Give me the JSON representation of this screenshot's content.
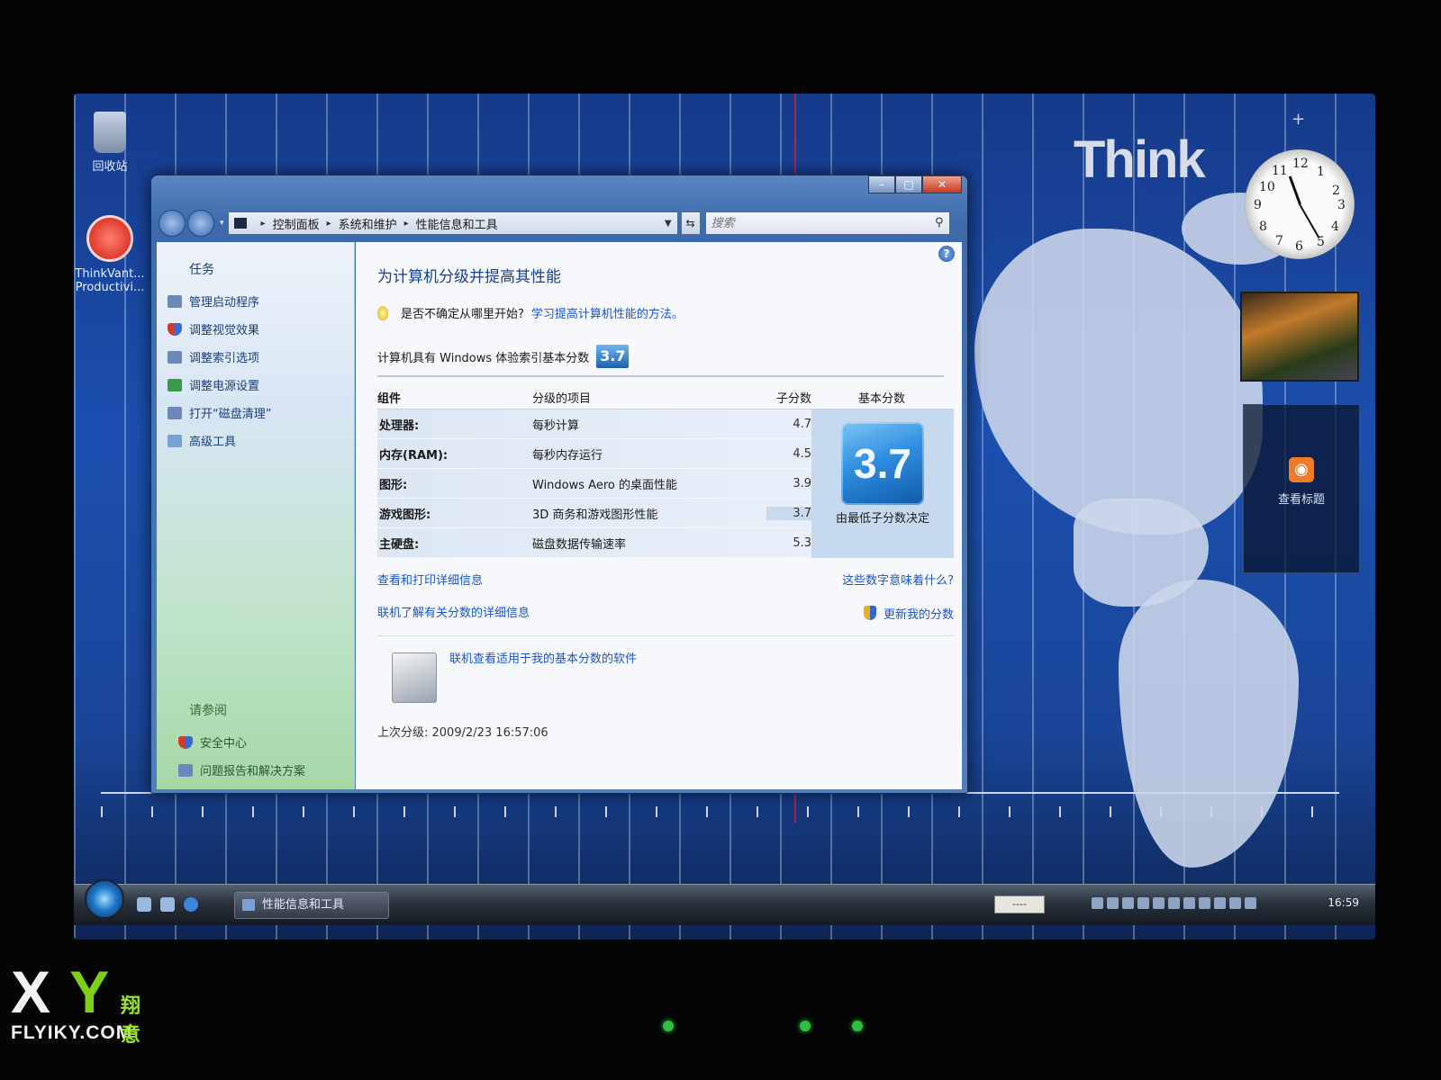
{
  "desktop": {
    "icons": [
      {
        "label": "回收站"
      },
      {
        "label": "ThinkVant... Productivi..."
      }
    ],
    "brand_text": "Think",
    "clock_numbers": [
      "12",
      "1",
      "2",
      "3",
      "4",
      "5",
      "6",
      "7",
      "8",
      "9",
      "10",
      "11"
    ],
    "feed_gadget_label": "查看标题"
  },
  "window": {
    "breadcrumbs": [
      "控制面板",
      "系统和维护",
      "性能信息和工具"
    ],
    "search_placeholder": "搜索",
    "tasks_heading": "任务",
    "tasks": [
      {
        "label": "管理启动程序",
        "icon": "startup-icon"
      },
      {
        "label": "调整视觉效果",
        "icon": "shield-icon"
      },
      {
        "label": "调整索引选项",
        "icon": "index-icon"
      },
      {
        "label": "调整电源设置",
        "icon": "power-icon"
      },
      {
        "label": "打开“磁盘清理”",
        "icon": "disk-cleanup-icon"
      },
      {
        "label": "高级工具",
        "icon": "tools-icon"
      }
    ],
    "see_also_heading": "请参阅",
    "see_also": [
      {
        "label": "安全中心"
      },
      {
        "label": "问题报告和解决方案"
      }
    ],
    "main": {
      "title": "为计算机分级并提高其性能",
      "tip_text": "是否不确定从哪里开始?",
      "tip_link": "学习提高计算机性能的方法。",
      "base_score_text": "计算机具有 Windows 体验索引基本分数",
      "base_score": "3.7",
      "table": {
        "headers": {
          "component": "组件",
          "rated_item": "分级的项目",
          "subscore": "子分数",
          "base_score": "基本分数"
        },
        "rows": [
          {
            "component": "处理器:",
            "item": "每秒计算",
            "subscore": "4.7"
          },
          {
            "component": "内存(RAM):",
            "item": "每秒内存运行",
            "subscore": "4.5"
          },
          {
            "component": "图形:",
            "item": "Windows Aero 的桌面性能",
            "subscore": "3.9"
          },
          {
            "component": "游戏图形:",
            "item": "3D 商务和游戏图形性能",
            "subscore": "3.7"
          },
          {
            "component": "主硬盘:",
            "item": "磁盘数据传输速率",
            "subscore": "5.3"
          }
        ],
        "base_note": "由最低子分数决定"
      },
      "link_print": "查看和打印详细信息",
      "link_meaning": "这些数字意味着什么?",
      "link_online_details": "联机了解有关分数的详细信息",
      "link_update": "更新我的分数",
      "link_software": "联机查看适用于我的基本分数的软件",
      "last_rating": "上次分级: 2009/2/23 16:57:06"
    }
  },
  "taskbar": {
    "active_task": "性能信息和工具",
    "clock": "16:59",
    "lang_box": "----"
  },
  "watermark": {
    "letters_x": "X",
    "letters_y": "Y",
    "cn": "翔意",
    "site": "FLYIKY.COM"
  }
}
